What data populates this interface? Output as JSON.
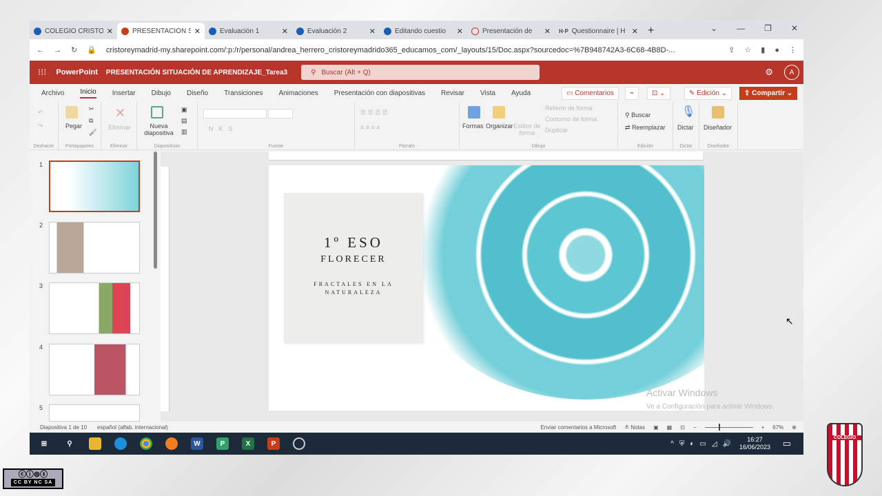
{
  "browser": {
    "tabs": [
      {
        "label": "COLEGIO CRISTO",
        "icon": "school-cap-icon"
      },
      {
        "label": "PRESENTACIÓN S",
        "icon": "powerpoint-icon",
        "active": true
      },
      {
        "label": "Evaluación 1",
        "icon": "school-cap-icon"
      },
      {
        "label": "Evaluación 2",
        "icon": "school-cap-icon"
      },
      {
        "label": "Editando cuestio",
        "icon": "school-cap-icon"
      },
      {
        "label": "Presentación de",
        "icon": "genially-icon"
      },
      {
        "label": "Questionnaire | H",
        "icon": "h5p-icon"
      }
    ],
    "url": "cristoreymadrid-my.sharepoint.com/:p:/r/personal/andrea_herrero_cristoreymadrido365_educamos_com/_layouts/15/Doc.aspx?sourcedoc=%7B948742A3-6C68-4B8D-..."
  },
  "app": {
    "name": "PowerPoint",
    "doc_title": "PRESENTACIÓN SITUACIÓN DE APRENDIZAJE_Tarea3",
    "search_placeholder": "Buscar (Alt + Q)",
    "avatar": "A",
    "accent": "#b7352a"
  },
  "menu": {
    "items": [
      "Archivo",
      "Inicio",
      "Insertar",
      "Dibujo",
      "Diseño",
      "Transiciones",
      "Animaciones",
      "Presentación con diapositivas",
      "Revisar",
      "Vista",
      "Ayuda"
    ],
    "comments": "Comentarios",
    "editing": "Edición",
    "share": "Compartir"
  },
  "ribbon": {
    "groups": [
      "Deshacer",
      "Portapapeles",
      "Eliminar",
      "Diapositivas",
      "Fuente",
      "Párrafo",
      "Dibujo",
      "Edición",
      "Dictar",
      "Diseñador"
    ],
    "paste": "Pegar",
    "delete": "Eliminar",
    "new_slide": "Nueva diapositiva",
    "shapes": "Formas",
    "arrange": "Organizar",
    "styles": "Estilos de forma",
    "fill": "Relleno de forma",
    "outline": "Contorno de forma",
    "duplicate": "Duplicar",
    "find": "Buscar",
    "replace": "Reemplazar",
    "dictate": "Dictar",
    "designer": "Diseñador"
  },
  "thumbnails": [
    "1",
    "2",
    "3",
    "4",
    "5"
  ],
  "slide": {
    "title": "1º ESO",
    "subtitle": "FLORECER",
    "tagline": "FRACTALES EN LA NATURALEZA"
  },
  "watermark": {
    "line1": "Activar Windows",
    "line2": "Ve a Configuración para activar Windows."
  },
  "status": {
    "slide": "Diapositiva 1 de 10",
    "language": "español (alfab. internacional)",
    "feedback": "Enviar comentarios a Microsoft",
    "notes": "Notas",
    "zoom": "67%"
  },
  "taskbar": {
    "time": "16:27",
    "date": "16/06/2023"
  },
  "license": "CC BY NC SA",
  "crest_text": "COLEGIO CR"
}
